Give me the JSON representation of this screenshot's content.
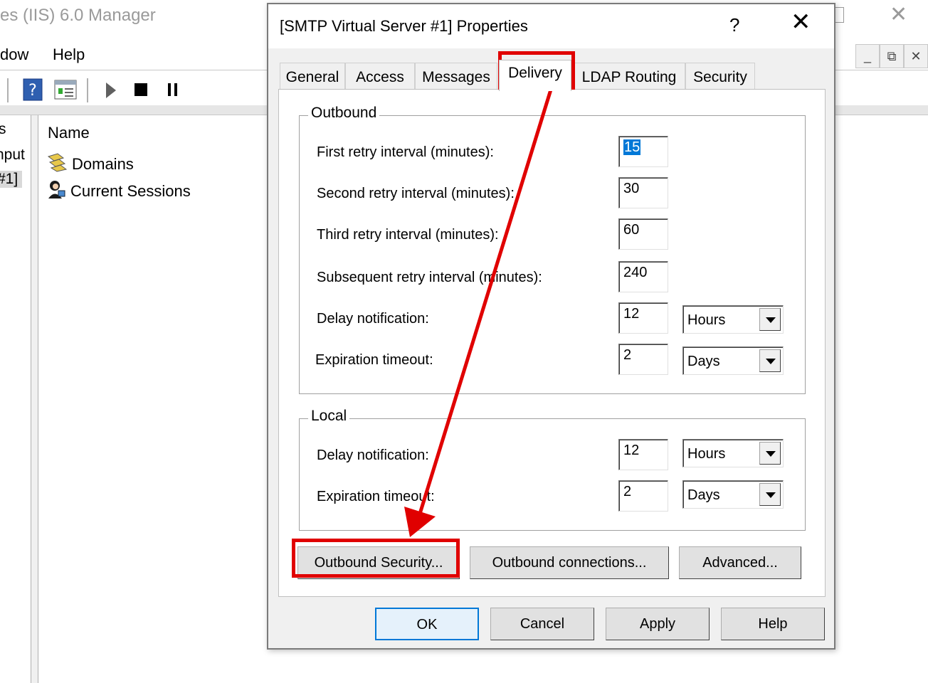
{
  "background": {
    "title": "es (IIS) 6.0 Manager",
    "menu": [
      "dow",
      "Help"
    ],
    "tree": {
      "items": [
        "s",
        "nput",
        "#1]"
      ]
    },
    "list": {
      "header": "Name",
      "rows": [
        "Domains",
        "Current Sessions"
      ]
    }
  },
  "dialog": {
    "title": "[SMTP Virtual Server #1] Properties",
    "help_glyph": "?",
    "close_glyph": "✕",
    "tabs": [
      "General",
      "Access",
      "Messages",
      "Delivery",
      "LDAP Routing",
      "Security"
    ],
    "active_tab": "Delivery",
    "outbound": {
      "label": "Outbound",
      "first_retry_label": "First retry interval (minutes):",
      "first_retry_value": "15",
      "second_retry_label": "Second retry interval (minutes):",
      "second_retry_value": "30",
      "third_retry_label": "Third retry interval (minutes):",
      "third_retry_value": "60",
      "subsequent_retry_label": "Subsequent retry interval (minutes):",
      "subsequent_retry_value": "240",
      "delay_label": "Delay notification:",
      "delay_value": "12",
      "delay_unit": "Hours",
      "expiration_label": "Expiration timeout:",
      "expiration_value": "2",
      "expiration_unit": "Days"
    },
    "local": {
      "label": "Local",
      "delay_label": "Delay notification:",
      "delay_value": "12",
      "delay_unit": "Hours",
      "expiration_label": "Expiration timeout:",
      "expiration_value": "2",
      "expiration_unit": "Days"
    },
    "buttons": {
      "outbound_security": "Outbound Security...",
      "outbound_connections": "Outbound connections...",
      "advanced": "Advanced...",
      "ok": "OK",
      "cancel": "Cancel",
      "apply": "Apply",
      "help": "Help"
    }
  },
  "annotation": {
    "highlight_color": "#e00000"
  }
}
